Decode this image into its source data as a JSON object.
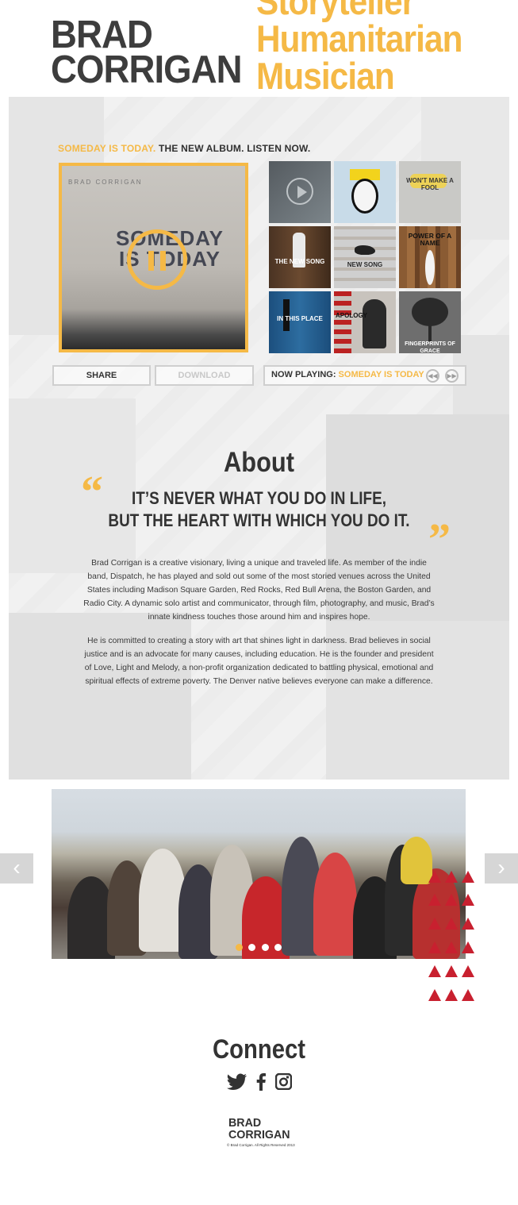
{
  "header": {
    "brand_line1": "BRAD",
    "brand_line2": "CORRIGAN",
    "taglines": [
      "Storyteller",
      "Humanitarian",
      "Musician"
    ]
  },
  "colors": {
    "accent": "#f5b946",
    "dark": "#333333",
    "triangles": "#c8202f"
  },
  "album": {
    "headline_highlight": "SOMEDAY IS TODAY.",
    "headline_rest": " THE NEW ALBUM. LISTEN NOW.",
    "cover_artist": "BRAD CORRIGAN",
    "cover_title": "SOMEDAY IS TODAY",
    "player_state": "playing",
    "grid": [
      {
        "label": ""
      },
      {
        "label": ""
      },
      {
        "label": "WON'T MAKE A FOOL"
      },
      {
        "label": "THE NEW SONG"
      },
      {
        "label": "NEW SONG"
      },
      {
        "label": "POWER OF A NAME"
      },
      {
        "label": "IN THIS PLACE"
      },
      {
        "label": "APOLOGY"
      },
      {
        "label": "FINGERPRINTS OF GRACE"
      }
    ]
  },
  "controls": {
    "share": "SHARE",
    "download": "DOWNLOAD",
    "now_playing_label": "NOW PLAYING: ",
    "now_playing_track": "SOMEDAY IS TODAY"
  },
  "about": {
    "title": "About",
    "quote_open": "“",
    "quote_close": "”",
    "quote_line1": "IT’S NEVER WHAT YOU DO IN LIFE,",
    "quote_line2": "BUT THE HEART WITH WHICH YOU DO IT.",
    "paragraph1": "Brad Corrigan is a creative visionary, living a unique and traveled life. As member of the indie band, Dispatch, he has played and sold out some of the most storied venues across the United States including Madison Square Garden, Red Rocks, Red Bull Arena, the Boston Garden, and Radio City. A dynamic solo artist and communicator, through film, photography, and music, Brad’s innate kindness touches those around him and inspires hope.",
    "paragraph2": "He is committed to creating a story with art that shines light in darkness. Brad believes in social justice and is an advocate for many causes, including education. He is the founder and president of Love, Light and Melody, a non-profit organization dedicated to battling physical, emotional and spiritual effects of extreme poverty. The Denver native believes everyone can make a difference."
  },
  "carousel": {
    "slide_count": 4,
    "active_index": 1
  },
  "connect": {
    "title": "Connect",
    "icons": [
      "twitter-icon",
      "facebook-icon",
      "instagram-icon"
    ]
  },
  "footer": {
    "brand_line1": "BRAD",
    "brand_line2": "CORRIGAN",
    "copyright": "© Brad Corrigan. All Rights Reserved 2013"
  }
}
